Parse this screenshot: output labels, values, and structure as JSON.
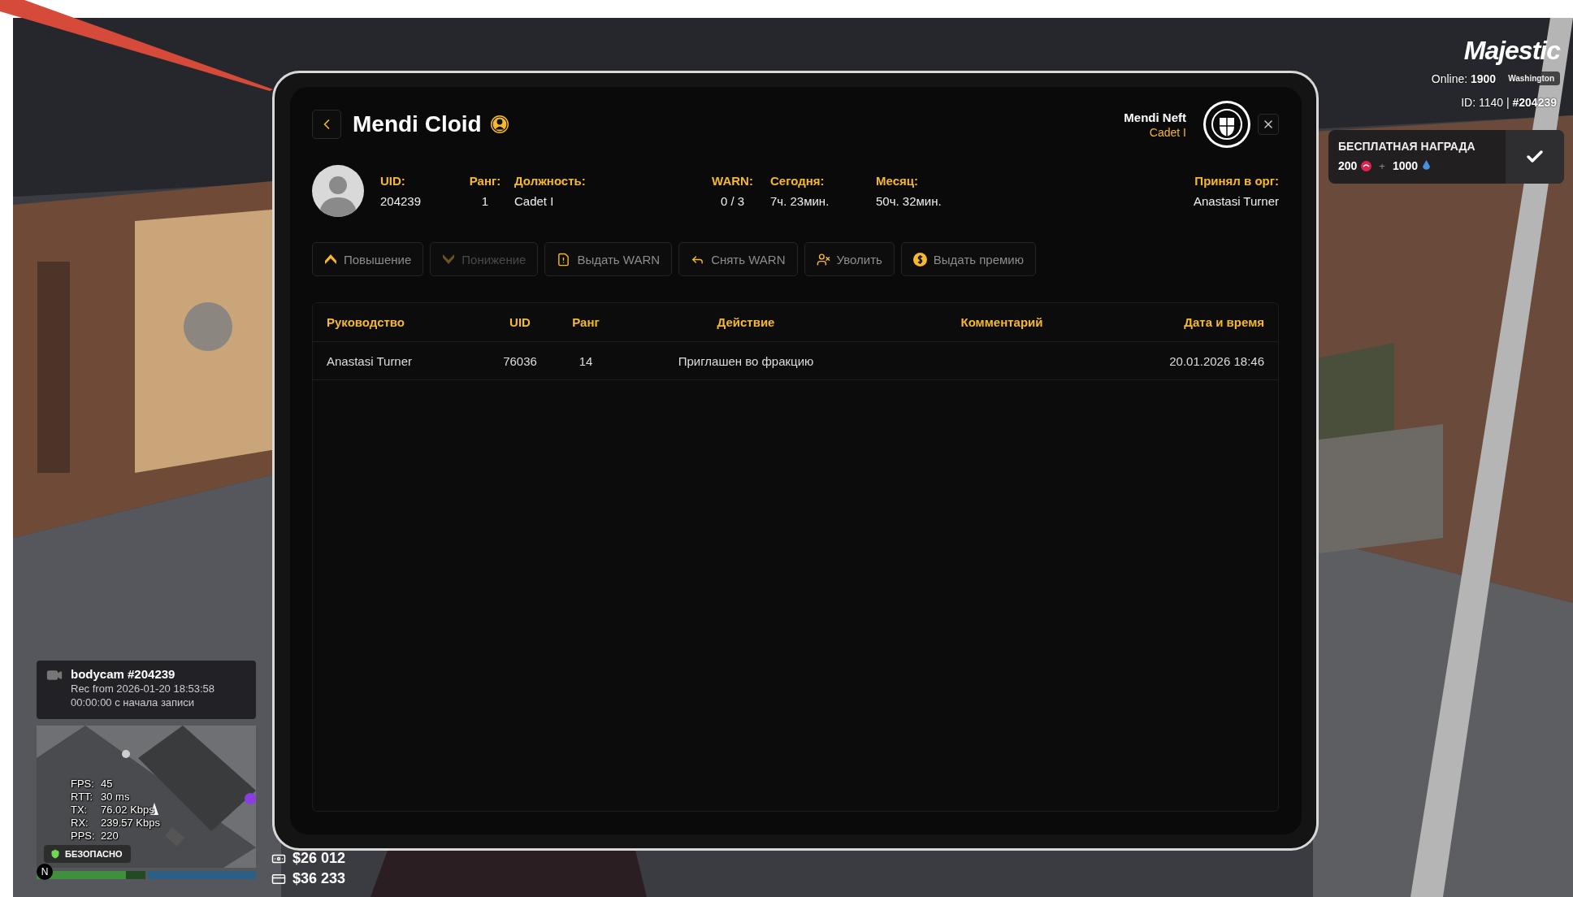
{
  "header": {
    "title": "Mendi Cloid",
    "member": {
      "name": "Mendi Neft",
      "rank": "Cadet I"
    }
  },
  "profile": {
    "fields": [
      {
        "label": "UID:",
        "value": "204239"
      },
      {
        "label": "Ранг:",
        "value": "1"
      },
      {
        "label": "Должность:",
        "value": "Cadet I"
      },
      {
        "label": "WARN:",
        "value": "0 / 3"
      },
      {
        "label": "Сегодня:",
        "value": "7ч. 23мин."
      },
      {
        "label": "Месяц:",
        "value": "50ч. 32мин."
      }
    ],
    "accepted_by": {
      "label": "Принял в орг:",
      "value": "Anastasi Turner"
    }
  },
  "actions": [
    {
      "kind": "promote",
      "label": "Повышение",
      "disabled": false
    },
    {
      "kind": "demote",
      "label": "Понижение",
      "disabled": true
    },
    {
      "kind": "warn",
      "label": "Выдать WARN",
      "disabled": false
    },
    {
      "kind": "unwarn",
      "label": "Снять WARN",
      "disabled": false
    },
    {
      "kind": "fire",
      "label": "Уволить",
      "disabled": false
    },
    {
      "kind": "bonus",
      "label": "Выдать премию",
      "disabled": false
    }
  ],
  "table": {
    "columns": [
      "Руководство",
      "UID",
      "Ранг",
      "Действие",
      "Комментарий",
      "Дата и время"
    ],
    "rows": [
      {
        "cells": [
          "Anastasi Turner",
          "76036",
          "14",
          "Приглашен во фракцию",
          "",
          "20.01.2026 18:46"
        ]
      }
    ]
  },
  "hud": {
    "brand": "Majestic",
    "online_label": "Online:",
    "online": "1900",
    "server": "Washington",
    "id_line": "ID: 1140 | **#204239**",
    "reward": {
      "title": "БЕСПЛАТНАЯ НАГРАДА",
      "amount_1": "200",
      "plus": "+",
      "amount_2": "1000"
    },
    "bodycam": {
      "title": "bodycam #204239",
      "recorded": "Rec from 2026-01-20 18:53:58",
      "elapsed": "00:00:00 с начала записи"
    },
    "stats": [
      {
        "label": "FPS:",
        "value": "45"
      },
      {
        "label": "RTT:",
        "value": "30 ms"
      },
      {
        "label": "TX:",
        "value": "76.02 Kbps"
      },
      {
        "label": "RX:",
        "value": "239.57 Kbps"
      },
      {
        "label": "PPS:",
        "value": "220"
      }
    ],
    "zone": "БЕЗОПАСНО",
    "compass": "N",
    "vitals": [
      {
        "kind": "health",
        "level": 0.82
      },
      {
        "kind": "armor",
        "level": 1
      }
    ],
    "money": [
      {
        "kind": "cash",
        "amount": "$26 012"
      },
      {
        "kind": "bank",
        "amount": "$36 233"
      }
    ]
  }
}
